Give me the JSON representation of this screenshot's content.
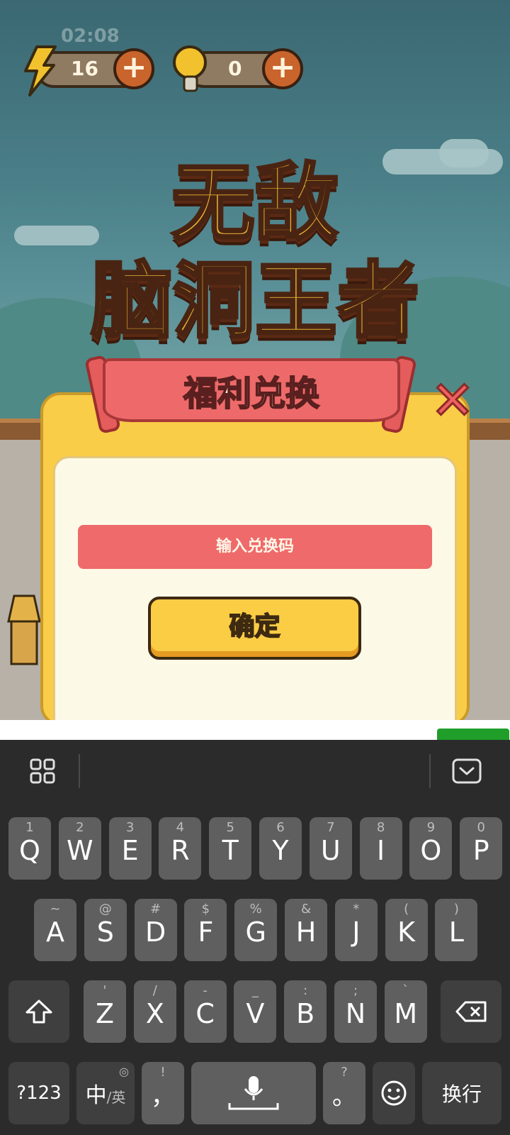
{
  "status": {
    "time": "02:08"
  },
  "resources": {
    "energy": {
      "icon": "lightning-icon",
      "value": "16"
    },
    "hint": {
      "icon": "lightbulb-icon",
      "value": "0"
    }
  },
  "title": {
    "line1": "无敌",
    "line2": "脑洞王者"
  },
  "dialog": {
    "banner": "福利兑换",
    "close": "✕",
    "input_placeholder": "输入兑换码",
    "confirm_label": "确定"
  },
  "keyboard": {
    "row1": [
      {
        "hint": "1",
        "key": "Q"
      },
      {
        "hint": "2",
        "key": "W"
      },
      {
        "hint": "3",
        "key": "E"
      },
      {
        "hint": "4",
        "key": "R"
      },
      {
        "hint": "5",
        "key": "T"
      },
      {
        "hint": "6",
        "key": "Y"
      },
      {
        "hint": "7",
        "key": "U"
      },
      {
        "hint": "8",
        "key": "I"
      },
      {
        "hint": "9",
        "key": "O"
      },
      {
        "hint": "0",
        "key": "P"
      }
    ],
    "row2": [
      {
        "hint": "~",
        "key": "A"
      },
      {
        "hint": "@",
        "key": "S"
      },
      {
        "hint": "#",
        "key": "D"
      },
      {
        "hint": "$",
        "key": "F"
      },
      {
        "hint": "%",
        "key": "G"
      },
      {
        "hint": "&",
        "key": "H"
      },
      {
        "hint": "*",
        "key": "J"
      },
      {
        "hint": "(",
        "key": "K"
      },
      {
        "hint": ")",
        "key": "L"
      }
    ],
    "row3": [
      {
        "hint": "'",
        "key": "Z"
      },
      {
        "hint": "/",
        "key": "X"
      },
      {
        "hint": "-",
        "key": "C"
      },
      {
        "hint": "_",
        "key": "V"
      },
      {
        "hint": ":",
        "key": "B"
      },
      {
        "hint": ";",
        "key": "N"
      },
      {
        "hint": "`",
        "key": "M"
      }
    ],
    "numbers_label": "?123",
    "lang_main": "中",
    "lang_alt": "/英",
    "comma_hint": "!",
    "comma_key": "，",
    "period_hint": "?",
    "period_key": "。",
    "enter_label": "换行"
  }
}
